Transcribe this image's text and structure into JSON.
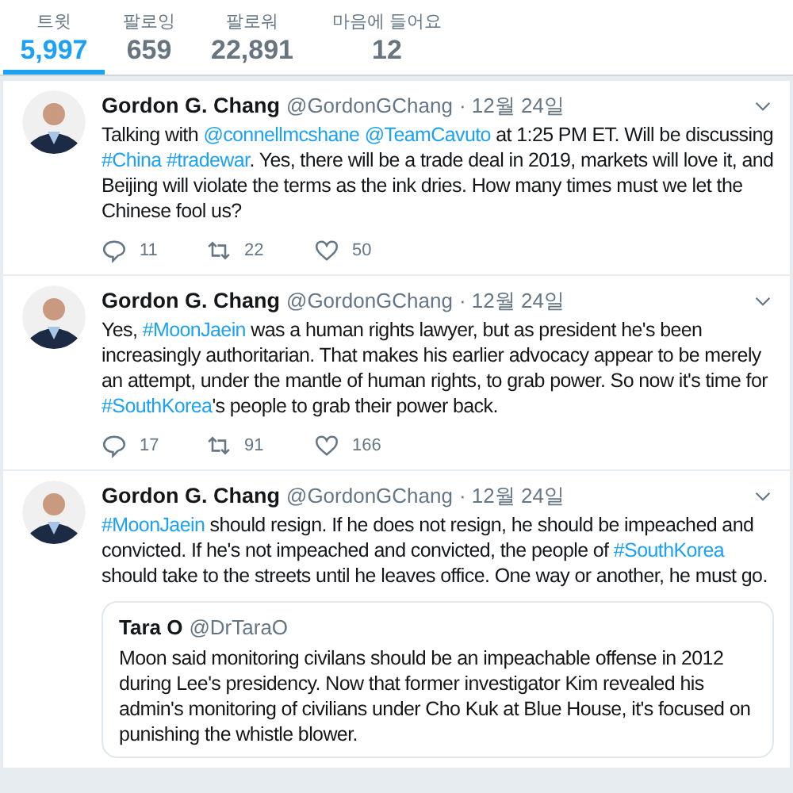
{
  "stats": [
    {
      "label": "트윗",
      "value": "5,997",
      "selected": true
    },
    {
      "label": "팔로잉",
      "value": "659",
      "selected": false
    },
    {
      "label": "팔로워",
      "value": "22,891",
      "selected": false
    },
    {
      "label": "마음에 들어요",
      "value": "12",
      "selected": false
    }
  ],
  "tweets": [
    {
      "name": "Gordon G. Chang",
      "handle": "@GordonGChang",
      "date": "· 12월 24일",
      "text": [
        {
          "kind": "text",
          "text": "Talking with "
        },
        {
          "kind": "link",
          "text": "@connellmcshane "
        },
        {
          "kind": "link",
          "text": "@TeamCavuto"
        },
        {
          "kind": "text",
          "text": " at 1:25 PM ET. Will be discussing "
        },
        {
          "kind": "link",
          "text": "#China "
        },
        {
          "kind": "link",
          "text": "#tradewar"
        },
        {
          "kind": "text",
          "text": ". Yes, there will be a trade deal in 2019, markets will love it, and Beijing will violate the terms as the ink dries. How many times must we let the Chinese fool us?"
        }
      ],
      "replies": "11",
      "retweets": "22",
      "likes": "50"
    },
    {
      "name": "Gordon G. Chang",
      "handle": "@GordonGChang",
      "date": "· 12월 24일",
      "text": [
        {
          "kind": "text",
          "text": "Yes, "
        },
        {
          "kind": "link",
          "text": "#MoonJaein"
        },
        {
          "kind": "text",
          "text": " was a human rights lawyer, but as president he's been increasingly authoritarian. That makes his earlier advocacy appear to be merely an attempt, under the mantle of human rights, to grab power. So now it's time for "
        },
        {
          "kind": "link",
          "text": "#SouthKorea"
        },
        {
          "kind": "text",
          "text": "'s people to grab their power back."
        }
      ],
      "replies": "17",
      "retweets": "91",
      "likes": "166"
    },
    {
      "name": "Gordon G. Chang",
      "handle": "@GordonGChang",
      "date": "· 12월 24일",
      "text": [
        {
          "kind": "link",
          "text": "#MoonJaein"
        },
        {
          "kind": "text",
          "text": " should resign. If he does not resign, he should be impeached and convicted. If he's not impeached and convicted, the people of "
        },
        {
          "kind": "link",
          "text": "#SouthKorea"
        },
        {
          "kind": "text",
          "text": " should take to the streets until he leaves office. One way or another, he must go."
        }
      ],
      "quote": {
        "name": "Tara O",
        "handle": "@DrTaraO",
        "text": "Moon said monitoring civilans should be an impeachable offense in 2012 during Lee's presidency.  Now that former investigator Kim revealed his admin's monitoring of civilians under Cho Kuk at Blue House, it's focused on punishing the whistle blower."
      }
    }
  ]
}
